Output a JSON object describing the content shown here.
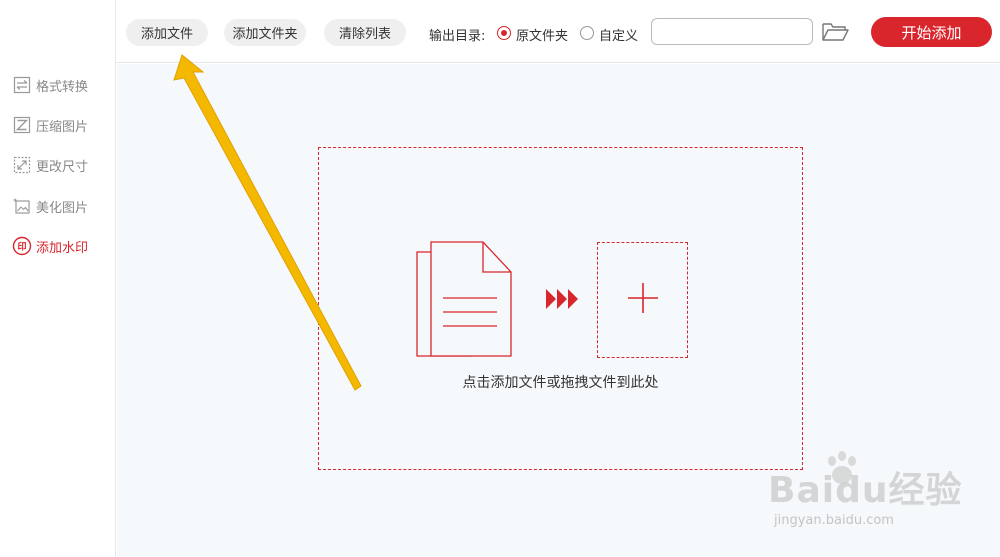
{
  "sidebar": {
    "items": [
      {
        "label": "格式转换",
        "icon": "swap-icon",
        "active": false
      },
      {
        "label": "压缩图片",
        "icon": "compress-icon",
        "active": false
      },
      {
        "label": "更改尺寸",
        "icon": "resize-icon",
        "active": false
      },
      {
        "label": "美化图片",
        "icon": "beautify-icon",
        "active": false
      },
      {
        "label": "添加水印",
        "icon": "watermark-stamp-icon",
        "active": true
      }
    ]
  },
  "toolbar": {
    "add_file_label": "添加文件",
    "add_folder_label": "添加文件夹",
    "clear_list_label": "清除列表",
    "output_dir_label": "输出目录:",
    "option_original_label": "原文件夹",
    "option_custom_label": "自定义",
    "selected_option": "原文件夹",
    "path_value": "",
    "start_label": "开始添加"
  },
  "main": {
    "drop_hint": "点击添加文件或拖拽文件到此处"
  },
  "watermark": {
    "logo_text": "Baidu经验",
    "url_text": "jingyan.baidu.com"
  },
  "colors": {
    "accent": "#d8262c",
    "arrow": "#f5b800",
    "main_bg": "#f5f9fc"
  }
}
